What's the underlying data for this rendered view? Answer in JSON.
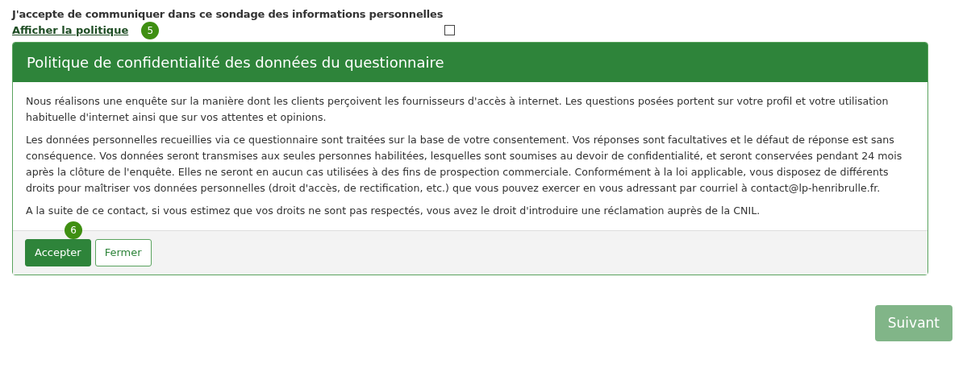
{
  "consent": {
    "label": "J'accepte de communiquer dans ce sondage des informations personnelles",
    "link": "Afficher la politique",
    "checked": false,
    "step_badge": "5"
  },
  "policy_card": {
    "title": "Politique de confidentialité des données du questionnaire",
    "paragraphs": [
      "Nous réalisons une enquête sur la manière dont les clients perçoivent les fournisseurs d'accès à internet. Les questions posées portent sur votre profil et votre utilisation habituelle d'internet ainsi que sur vos attentes et opinions.",
      "Les données personnelles recueillies via ce questionnaire sont traitées sur la base de votre consentement. Vos réponses sont facultatives et le défaut de réponse est sans conséquence. Vos données seront transmises aux seules personnes habilitées, lesquelles sont soumises au devoir de confidentialité, et seront conservées pendant 24 mois après la clôture de l'enquête. Elles ne seront en aucun cas utilisées à des fins de prospection commerciale. Conformément à la loi applicable, vous disposez de différents droits pour maîtriser vos données personnelles (droit d'accès, de rectification, etc.) que vous pouvez exercer en vous adressant par courriel à contact@lp-henribrulle.fr.",
      "A la suite de ce contact, si vous estimez que vos droits ne sont pas respectés, vous avez le droit d'introduire une réclamation auprès de la CNIL."
    ],
    "step_badge": "6",
    "buttons": [
      {
        "label": "Accepter",
        "kind": "primary"
      },
      {
        "label": "Fermer",
        "kind": "outline"
      }
    ]
  },
  "next_button": {
    "label": "Suivant",
    "disabled": true
  }
}
